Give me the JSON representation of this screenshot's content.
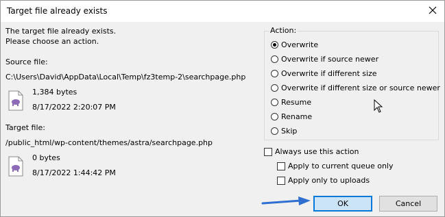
{
  "window": {
    "title": "Target file already exists"
  },
  "message": {
    "line1": "The target file already exists.",
    "line2": "Please choose an action."
  },
  "source": {
    "label": "Source file:",
    "path": "C:\\Users\\David\\AppData\\Local\\Temp\\fz3temp-2\\searchpage.php",
    "size": "1,384 bytes",
    "date": "8/17/2022 2:20:07 PM"
  },
  "target": {
    "label": "Target file:",
    "path": "/public_html/wp-content/themes/astra/searchpage.php",
    "size": "0 bytes",
    "date": "8/17/2022 1:44:42 PM"
  },
  "action": {
    "label": "Action:",
    "selected": "Overwrite",
    "options": [
      "Overwrite",
      "Overwrite if source newer",
      "Overwrite if different size",
      "Overwrite if different size or source newer",
      "Resume",
      "Rename",
      "Skip"
    ]
  },
  "checks": {
    "always": "Always use this action",
    "queue": "Apply to current queue only",
    "uploads": "Apply only to uploads"
  },
  "buttons": {
    "ok": "OK",
    "cancel": "Cancel"
  },
  "colors": {
    "accent": "#0078d7",
    "arrow": "#2f6fd0",
    "icon": "#8e6bb8"
  }
}
